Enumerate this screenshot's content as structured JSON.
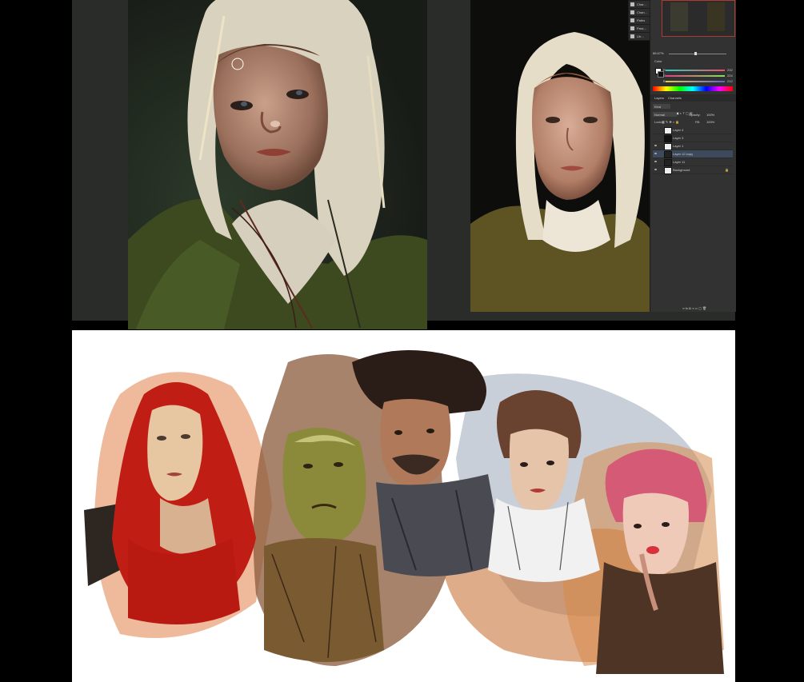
{
  "colors": {
    "background": "#000000",
    "workspace": "#2a2c29",
    "panel": "#323232",
    "accent_red": "#c8281e",
    "highlight": "#d43a2a"
  },
  "photoshop": {
    "tools_panel": {
      "items": [
        "Char…",
        "Chan…",
        "Paths",
        "Para…",
        "Lib…"
      ]
    },
    "navigator": {
      "zoom": "66.67%"
    },
    "color_panel": {
      "tab": "Color",
      "channels": [
        {
          "label": "R",
          "value": "232"
        },
        {
          "label": "G",
          "value": "224"
        },
        {
          "label": "B",
          "value": "212"
        }
      ]
    },
    "layers_panel": {
      "tabs": [
        "Layers",
        "Channels"
      ],
      "kind_label": "Kind",
      "blend_mode": "Normal",
      "opacity_label": "Opacity:",
      "opacity_value": "100%",
      "lock_label": "Lock:",
      "fill_label": "Fill:",
      "fill_value": "100%",
      "layers": [
        {
          "name": "Layer 4"
        },
        {
          "name": "Layer 3"
        },
        {
          "name": "Layer 1"
        },
        {
          "name": "Layer 12 copy"
        },
        {
          "name": "Layer 11"
        },
        {
          "name": "Background"
        }
      ]
    }
  }
}
